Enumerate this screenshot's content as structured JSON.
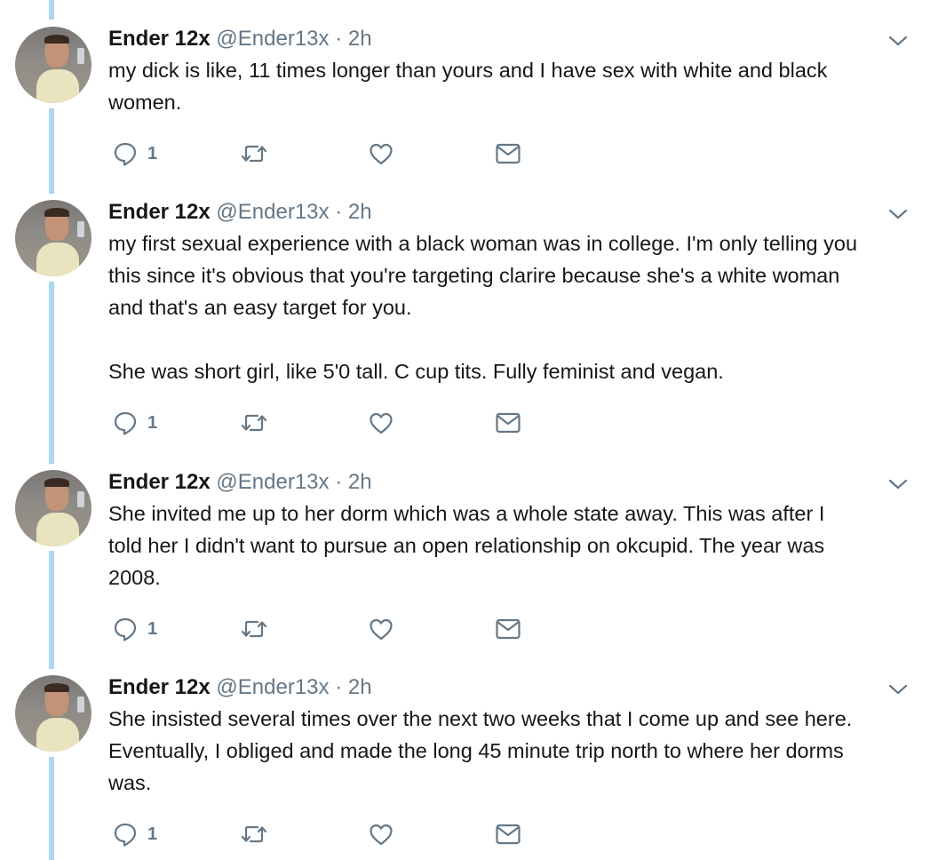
{
  "tweets": [
    {
      "name": "Ender 12x",
      "handle": "@Ender13x",
      "separator": "·",
      "time": "2h",
      "text": "my dick is like, 11 times longer than yours and I have sex with white and black\nwomen.",
      "reply_count": "1",
      "avatar_icon": "profile-photo"
    },
    {
      "name": "Ender 12x",
      "handle": "@Ender13x",
      "separator": "·",
      "time": "2h",
      "text": "my first sexual experience with a black woman was in college. I'm only telling you\nthis since it's obvious that you're targeting clarire because she's a white woman\nand that's an easy target for you.\n\nShe was short girl, like 5'0 tall. C cup tits. Fully feminist and vegan.",
      "reply_count": "1",
      "avatar_icon": "profile-photo"
    },
    {
      "name": "Ender 12x",
      "handle": "@Ender13x",
      "separator": "·",
      "time": "2h",
      "text": "She invited me up to her dorm which was a whole state away. This was after I\ntold her I didn't want to pursue an open relationship on okcupid. The year was\n2008.",
      "reply_count": "1",
      "avatar_icon": "profile-photo"
    },
    {
      "name": "Ender 12x",
      "handle": "@Ender13x",
      "separator": "·",
      "time": "2h",
      "text": "She insisted several times over the next two weeks that I come up and see here.\nEventually, I obliged and made the long 45 minute trip north to where her dorms\nwas.",
      "reply_count": "1",
      "avatar_icon": "profile-photo"
    }
  ],
  "icons": {
    "reply": "reply-icon",
    "retweet": "retweet-icon",
    "like": "heart-icon",
    "dm": "envelope-icon",
    "caret": "chevron-down-icon"
  },
  "colors": {
    "thread_line": "#aad8f3",
    "icon_gray": "#657786",
    "text": "#14171a"
  }
}
